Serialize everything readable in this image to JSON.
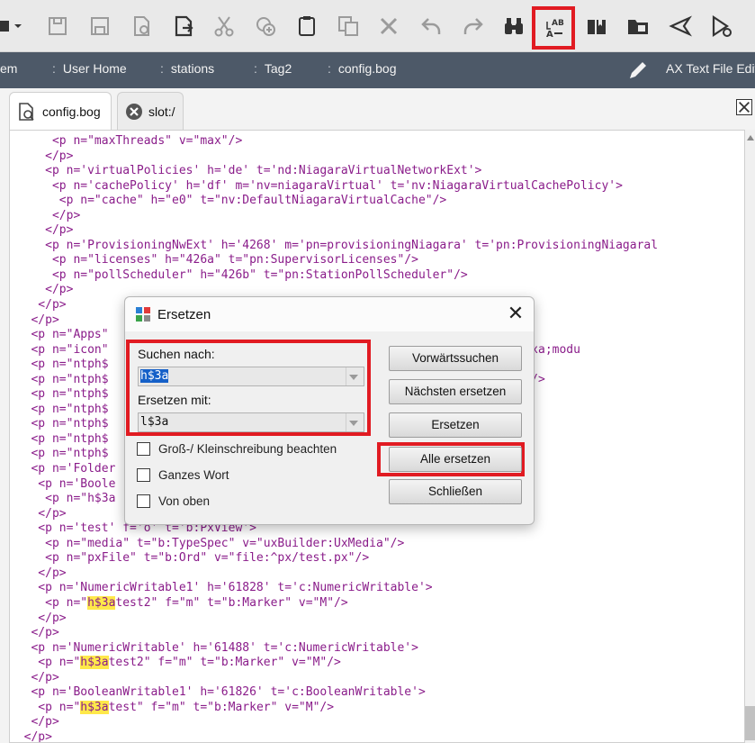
{
  "toolbar": {
    "buttons": [
      {
        "name": "menu-icon"
      },
      {
        "name": "save-icon"
      },
      {
        "name": "save-all-icon"
      },
      {
        "name": "new-file-icon"
      },
      {
        "name": "export-icon"
      },
      {
        "name": "cut-icon"
      },
      {
        "name": "copy-icon"
      },
      {
        "name": "paste-icon"
      },
      {
        "name": "duplicate-icon"
      },
      {
        "name": "delete-icon"
      },
      {
        "name": "undo-icon"
      },
      {
        "name": "redo-icon"
      },
      {
        "name": "find-icon"
      },
      {
        "name": "replace-icon"
      },
      {
        "name": "bookmark-icon"
      },
      {
        "name": "folder-icon"
      },
      {
        "name": "send-icon"
      },
      {
        "name": "run-icon"
      }
    ],
    "highlight_color": "#e11b22"
  },
  "breadcrumb": {
    "items": [
      "em",
      "User Home",
      "stations",
      "Tag2",
      "config.bog"
    ],
    "view_name": "AX Text File Edit"
  },
  "tabs": [
    {
      "label": "config.bog",
      "icon": "document-icon"
    },
    {
      "label": "slot:/",
      "icon": "close-circle-icon"
    }
  ],
  "editor": {
    "lines": [
      [
        {
          "t": "      <p n=\"maxThreads\" v=\"max\"/>"
        }
      ],
      [
        {
          "t": "     </p>"
        }
      ],
      [
        {
          "t": "     <p n='virtualPolicies' h='de' t='nd:NiagaraVirtualNetworkExt'>"
        }
      ],
      [
        {
          "t": "      <p n='cachePolicy' h='df' m='nv=niagaraVirtual' t='nv:NiagaraVirtualCachePolicy'>"
        }
      ],
      [
        {
          "t": "       <p n=\"cache\" h=\"e0\" t=\"nv:DefaultNiagaraVirtualCache\"/>"
        }
      ],
      [
        {
          "t": "      </p>"
        }
      ],
      [
        {
          "t": "     </p>"
        }
      ],
      [
        {
          "t": "     <p n='ProvisioningNwExt' h='4268' m='pn=provisioningNiagara' t='pn:ProvisioningNiagaral"
        }
      ],
      [
        {
          "t": "      <p n=\"licenses\" h=\"426a\" t=\"pn:SupervisorLicenses\"/>"
        }
      ],
      [
        {
          "t": "      <p n=\"pollScheduler\" h=\"426b\" t=\"pn:StationPollScheduler\"/>"
        }
      ],
      [
        {
          "t": "     </p>"
        }
      ],
      [
        {
          "t": "    </p>"
        }
      ],
      [
        {
          "t": "   </p>"
        }
      ],
      [
        {
          "t": "   <p n=\"Apps\""
        }
      ],
      [
        {
          "t": "   <p n=\"icon\"                                         stemDbService.png&#xa;modu"
        }
      ],
      [
        {
          "t": "   <p n=\"ntph$"
        }
      ],
      [
        {
          "t": "   <p n=\"ntph$                                          ationWindows.ntpl\"/>"
        }
      ],
      [
        {
          "t": "   <p n=\"ntph$"
        }
      ],
      [
        {
          "t": "   <p n=\"ntph$                                          onWindows\"/>"
        }
      ],
      [
        {
          "t": "   <p n=\"ntph$"
        }
      ],
      [
        {
          "t": "   <p n=\"ntph$"
        }
      ],
      [
        {
          "t": "   <p n=\"ntph$                                          dc-32b6b630311c\"/>"
        }
      ],
      [
        {
          "t": "   <p n='Folder"
        }
      ],
      [
        {
          "t": "    <p n='Boole"
        }
      ],
      [
        {
          "t": "     <p n=\"h$3a"
        }
      ],
      [
        {
          "t": "    </p>"
        }
      ],
      [
        {
          "t": "    <p n='test' f='o' t='b:PxView'>"
        }
      ],
      [
        {
          "t": "     <p n=\"media\" t=\"b:TypeSpec\" v=\"uxBuilder:UxMedia\"/>"
        }
      ],
      [
        {
          "t": "     <p n=\"pxFile\" t=\"b:Ord\" v=\"file:^px/test.px\"/>"
        }
      ],
      [
        {
          "t": "    </p>"
        }
      ],
      [
        {
          "t": "    <p n='NumericWritable1' h='61828' t='c:NumericWritable'>"
        }
      ],
      [
        {
          "t": "     <p n=\""
        },
        {
          "t": "h$3a",
          "hl": true
        },
        {
          "t": "test2\" f=\"m\" t=\"b:Marker\" v=\"M\"/>"
        }
      ],
      [
        {
          "t": "    </p>"
        }
      ],
      [
        {
          "t": "   </p>"
        }
      ],
      [
        {
          "t": "   <p n='NumericWritable' h='61488' t='c:NumericWritable'>"
        }
      ],
      [
        {
          "t": "    <p n=\""
        },
        {
          "t": "h$3a",
          "hl": true
        },
        {
          "t": "test2\" f=\"m\" t=\"b:Marker\" v=\"M\"/>"
        }
      ],
      [
        {
          "t": "   </p>"
        }
      ],
      [
        {
          "t": "   <p n='BooleanWritable1' h='61826' t='c:BooleanWritable'>"
        }
      ],
      [
        {
          "t": "    <p n=\""
        },
        {
          "t": "h$3a",
          "hl": true
        },
        {
          "t": "test\" f=\"m\" t=\"b:Marker\" v=\"M\"/>"
        }
      ],
      [
        {
          "t": "   </p>"
        }
      ],
      [
        {
          "t": "  </p>"
        }
      ]
    ],
    "text_color": "#8a1c8a",
    "highlight_color": "#ffe84a"
  },
  "dialog": {
    "title": "Ersetzen",
    "find_label": "Suchen nach:",
    "find_value": "h$3a",
    "replace_label": "Ersetzen mit:",
    "replace_value": "l$3a",
    "options": [
      "Groß-/ Kleinschreibung beachten",
      "Ganzes Wort",
      "Von oben"
    ],
    "buttons": {
      "find_forward": "Vorwärtssuchen",
      "replace_next": "Nächsten ersetzen",
      "replace": "Ersetzen",
      "replace_all": "Alle ersetzen",
      "close": "Schließen"
    },
    "close_glyph": "✕"
  }
}
